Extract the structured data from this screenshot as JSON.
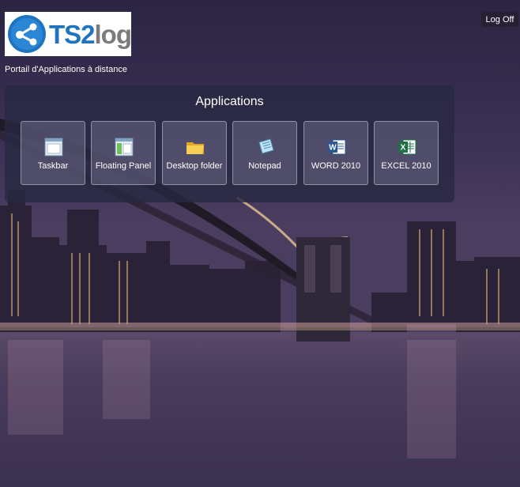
{
  "header": {
    "logo_text_primary": "TS2",
    "logo_text_secondary": "log",
    "subtitle": "Portail d'Applications à distance",
    "logoff_label": "Log Off"
  },
  "panel": {
    "title": "Applications",
    "apps": [
      {
        "label": "Taskbar",
        "icon": "window-icon"
      },
      {
        "label": "Floating Panel",
        "icon": "floating-panel-icon"
      },
      {
        "label": "Desktop folder",
        "icon": "folder-icon"
      },
      {
        "label": "Notepad",
        "icon": "notepad-icon"
      },
      {
        "label": "WORD 2010",
        "icon": "word-icon"
      },
      {
        "label": "EXCEL 2010",
        "icon": "excel-icon"
      }
    ]
  },
  "colors": {
    "logo_blue": "#1f74c0",
    "logo_gray": "#7b7b7b",
    "word_blue": "#2b5797",
    "excel_green": "#1e7145"
  }
}
